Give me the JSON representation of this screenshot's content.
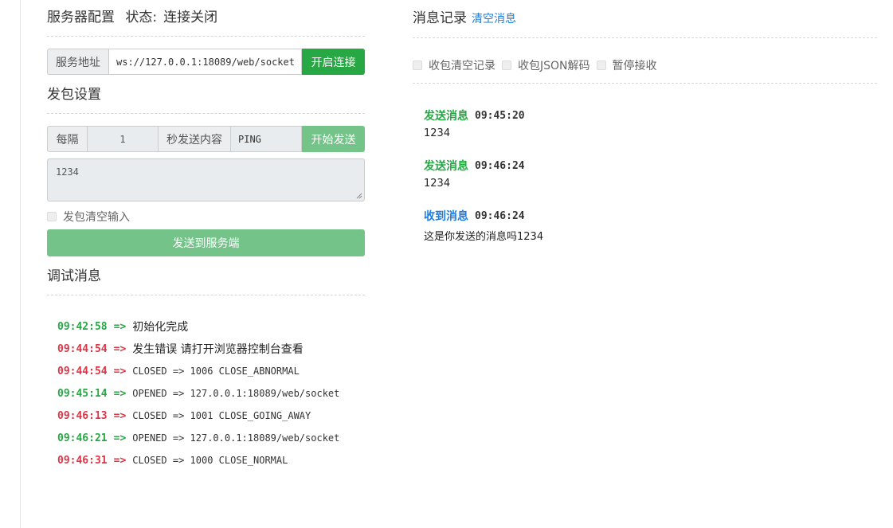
{
  "server": {
    "title": "服务器配置",
    "status_label": "状态:",
    "status_value": "连接关闭",
    "address_label": "服务地址",
    "address_value": "ws://127.0.0.1:18089/web/socket",
    "connect_button": "开启连接"
  },
  "send_settings": {
    "title": "发包设置",
    "interval_label": "每隔",
    "interval_value": "1",
    "content_label": "秒发送内容",
    "content_value": "PING",
    "start_button": "开始发送",
    "message_text": "1234",
    "clear_checkbox_label": "发包清空输入",
    "send_button": "发送到服务端"
  },
  "debug": {
    "title": "调试消息",
    "arrow": "=>",
    "logs": [
      {
        "time": "09:42:58",
        "level": "ok",
        "text": "初始化完成",
        "cn": true
      },
      {
        "time": "09:44:54",
        "level": "err",
        "text": "发生错误 请打开浏览器控制台查看",
        "cn": true
      },
      {
        "time": "09:44:54",
        "level": "err",
        "text": "CLOSED => 1006 CLOSE_ABNORMAL",
        "cn": false
      },
      {
        "time": "09:45:14",
        "level": "ok",
        "text": "OPENED => 127.0.0.1:18089/web/socket",
        "cn": false
      },
      {
        "time": "09:46:13",
        "level": "err",
        "text": "CLOSED => 1001 CLOSE_GOING_AWAY",
        "cn": false
      },
      {
        "time": "09:46:21",
        "level": "ok",
        "text": "OPENED => 127.0.0.1:18089/web/socket",
        "cn": false
      },
      {
        "time": "09:46:31",
        "level": "err",
        "text": "CLOSED => 1000 CLOSE_NORMAL",
        "cn": false
      }
    ]
  },
  "records": {
    "title": "消息记录",
    "clear_link": "清空消息",
    "options": [
      "收包清空记录",
      "收包JSON解码",
      "暂停接收"
    ],
    "messages": [
      {
        "type": "sent",
        "label": "发送消息",
        "time": "09:45:20",
        "body": "1234"
      },
      {
        "type": "sent",
        "label": "发送消息",
        "time": "09:46:24",
        "body": "1234"
      },
      {
        "type": "recv",
        "label": "收到消息",
        "time": "09:46:24",
        "body": "这是你发送的消息吗1234"
      }
    ]
  },
  "colors": {
    "success": "#28a745",
    "success_disabled": "#74c48a",
    "error": "#dc3545",
    "link": "#1e7ee0"
  }
}
